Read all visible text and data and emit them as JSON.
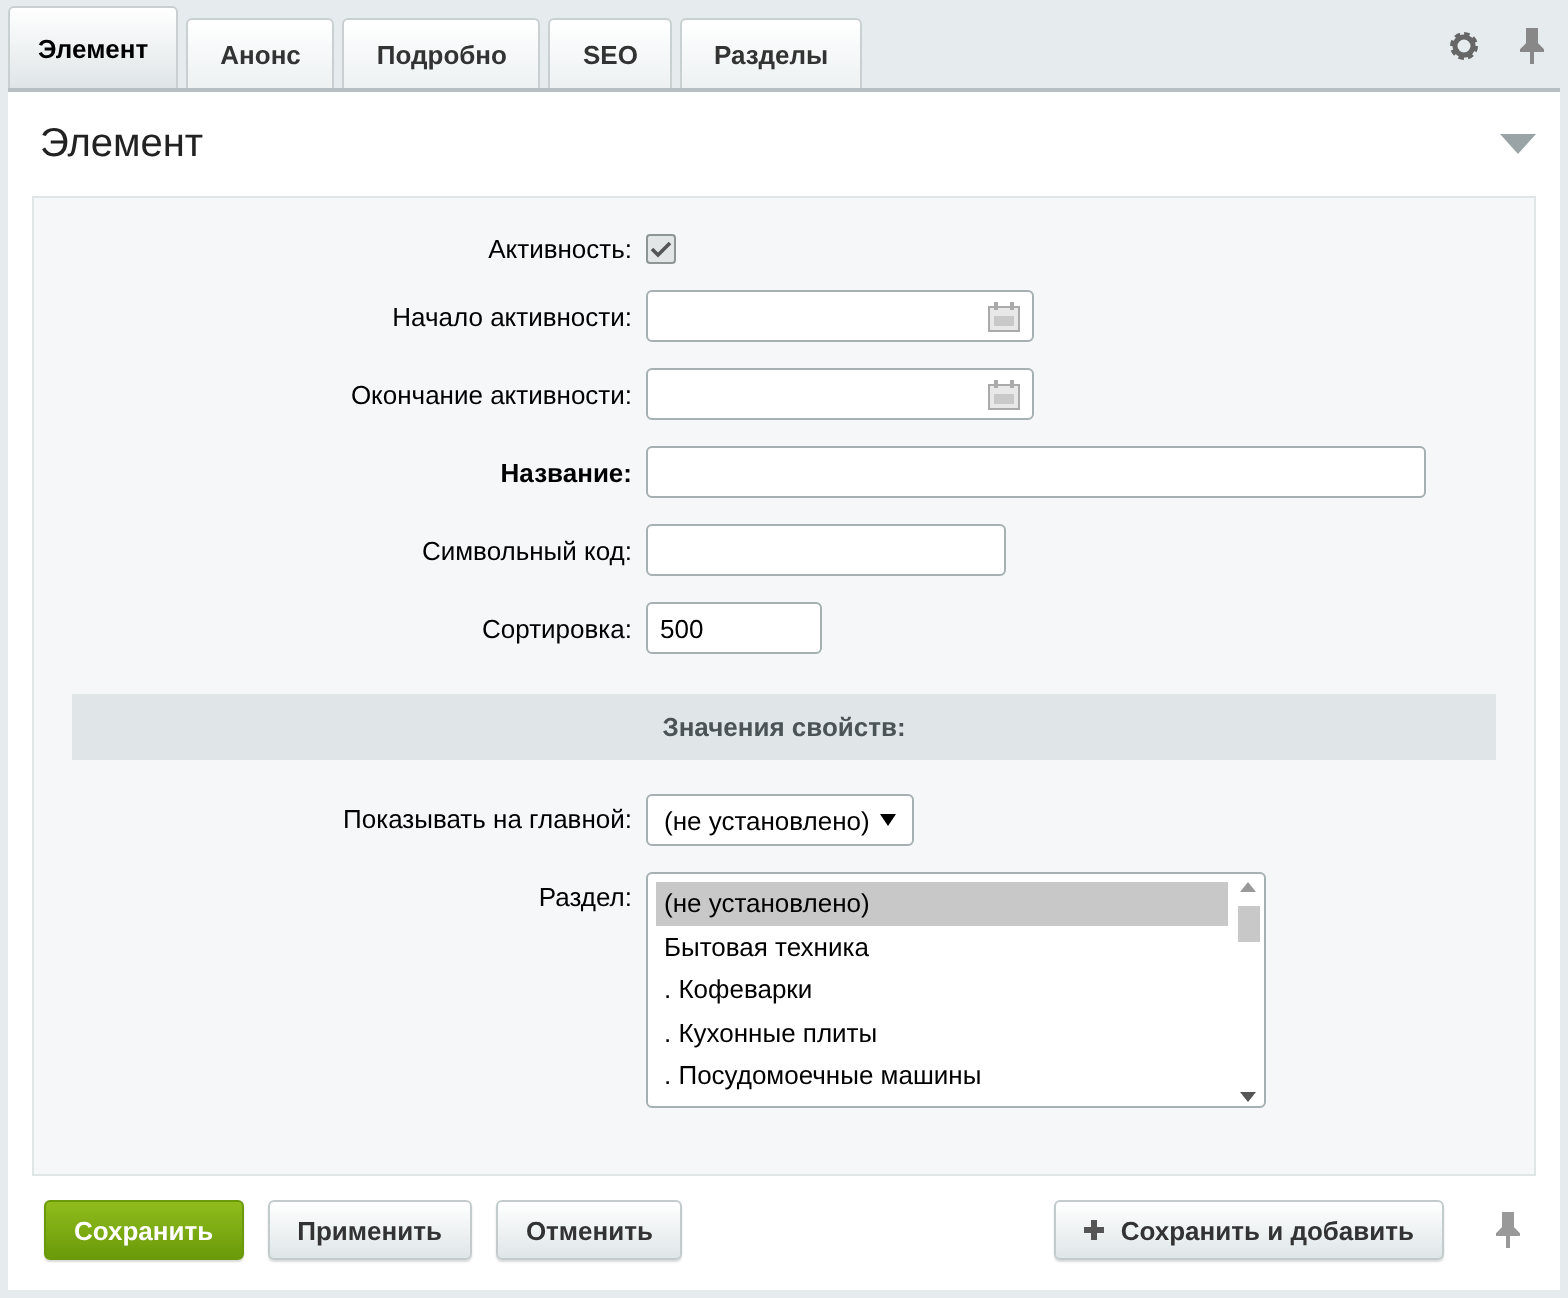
{
  "tabs": [
    {
      "label": "Элемент",
      "selected": true
    },
    {
      "label": "Анонс",
      "selected": false
    },
    {
      "label": "Подробно",
      "selected": false
    },
    {
      "label": "SEO",
      "selected": false
    },
    {
      "label": "Разделы",
      "selected": false
    }
  ],
  "panel": {
    "title": "Элемент",
    "expanded": true
  },
  "fields": [
    {
      "kind": "checkbox",
      "label": "Активность:",
      "checked": true
    },
    {
      "kind": "date",
      "label": "Начало активности:"
    },
    {
      "kind": "date",
      "label": "Окончание активности:"
    },
    {
      "kind": "widetext",
      "label": "Название:",
      "bold": true
    },
    {
      "kind": "text",
      "label": "Символьный код:"
    },
    {
      "kind": "shorttext",
      "label": "Сортировка:",
      "value": "500"
    }
  ],
  "properties": {
    "heading": "Значения свойств:",
    "select": {
      "label": "Показывать на главной:",
      "value": "(не установлено)"
    },
    "listbox": {
      "label": "Раздел:",
      "options": [
        {
          "label": "(не установлено)",
          "selected": true
        },
        {
          "label": "Бытовая техника",
          "selected": false
        },
        {
          "label": ". Кофеварки",
          "selected": false
        },
        {
          "label": ". Кухонные плиты",
          "selected": false
        },
        {
          "label": ". Посудомоечные машины",
          "selected": false
        }
      ]
    }
  },
  "buttons": [
    {
      "kind": "primary",
      "label": "Сохранить"
    },
    {
      "kind": "normal",
      "label": "Применить"
    },
    {
      "kind": "normal",
      "label": "Отменить"
    },
    {
      "kind": "add",
      "label": "Сохранить и добавить"
    }
  ]
}
